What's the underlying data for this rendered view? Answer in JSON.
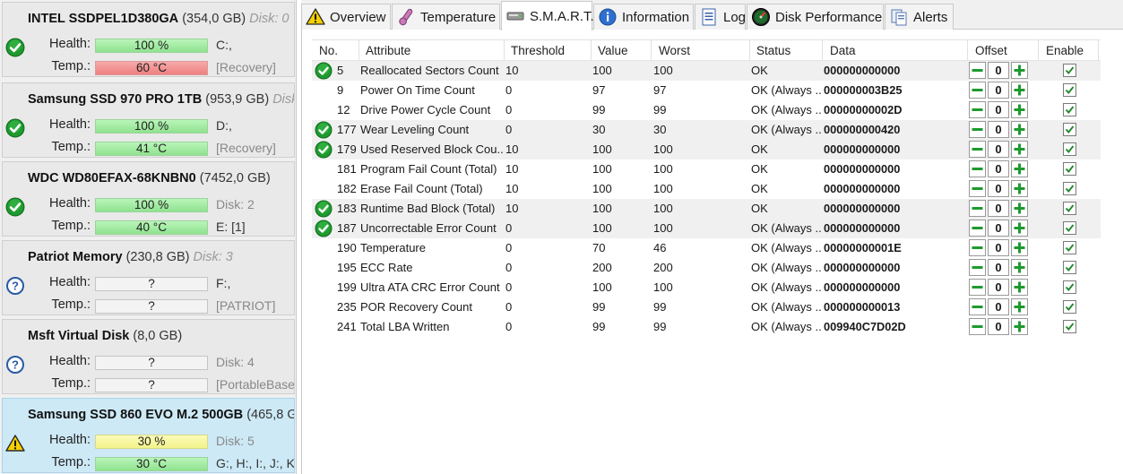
{
  "disks": [
    {
      "name": "INTEL SSDPEL1D380GA",
      "size": "(354,0 GB)",
      "disk_label": "Disk: 0",
      "status": "ok",
      "health_label": "Health:",
      "health_value": "100 %",
      "health_color": "green",
      "drives": "C:,",
      "temp_label": "Temp.:",
      "temp_value": "60 °C",
      "temp_color": "red",
      "volume": "[Recovery]"
    },
    {
      "name": "Samsung SSD 970 PRO 1TB",
      "size": "(953,9 GB)",
      "disk_label": "Disk",
      "status": "ok",
      "health_label": "Health:",
      "health_value": "100 %",
      "health_color": "green",
      "drives": "D:,",
      "temp_label": "Temp.:",
      "temp_value": "41 °C",
      "temp_color": "green",
      "volume": "[Recovery]"
    },
    {
      "name": "WDC WD80EFAX-68KNBN0",
      "size": "(7452,0 GB)",
      "disk_label": "",
      "status": "ok",
      "health_label": "Health:",
      "health_value": "100 %",
      "health_color": "green",
      "drives": "Disk: 2",
      "temp_label": "Temp.:",
      "temp_value": "40 °C",
      "temp_color": "green",
      "volume": "E: [1]"
    },
    {
      "name": "Patriot Memory",
      "size": "(230,8 GB)",
      "disk_label": "Disk: 3",
      "status": "unknown",
      "health_label": "Health:",
      "health_value": "?",
      "health_color": "empty",
      "drives": "F:,",
      "temp_label": "Temp.:",
      "temp_value": "?",
      "temp_color": "empty",
      "volume": "[PATRIOT]"
    },
    {
      "name": "Msft    Virtual Disk",
      "size": "(8,0 GB)",
      "disk_label": "",
      "status": "unknown",
      "health_label": "Health:",
      "health_value": "?",
      "health_color": "empty",
      "drives": "Disk: 4",
      "temp_label": "Temp.:",
      "temp_value": "?",
      "temp_color": "empty",
      "volume": "[PortableBase"
    },
    {
      "name": "Samsung SSD 860 EVO M.2 500GB",
      "size": "(465,8 G",
      "disk_label": "",
      "status": "warning",
      "health_label": "Health:",
      "health_value": "30 %",
      "health_color": "yellow",
      "drives": "Disk: 5",
      "temp_label": "Temp.:",
      "temp_value": "30 °C",
      "temp_color": "green",
      "volume": "G:, H:, I:, J:, K:"
    }
  ],
  "tabs": [
    {
      "label": "Overview",
      "icon": "warning-icon"
    },
    {
      "label": "Temperature",
      "icon": "thermometer-icon"
    },
    {
      "label": "S.M.A.R.T.",
      "icon": "drive-icon"
    },
    {
      "label": "Information",
      "icon": "info-icon"
    },
    {
      "label": "Log",
      "icon": "log-icon"
    },
    {
      "label": "Disk Performance",
      "icon": "gauge-icon"
    },
    {
      "label": "Alerts",
      "icon": "alerts-icon"
    }
  ],
  "active_tab": "S.M.A.R.T.",
  "columns": {
    "no": "No.",
    "attribute": "Attribute",
    "threshold": "Threshold",
    "value": "Value",
    "worst": "Worst",
    "status": "Status",
    "data": "Data",
    "offset": "Offset",
    "enable": "Enable"
  },
  "rows": [
    {
      "no": "5",
      "attribute": "Reallocated Sectors Count",
      "threshold": "10",
      "value": "100",
      "worst": "100",
      "status": "OK",
      "data": "000000000000",
      "offset": "0",
      "enabled": true,
      "ok_icon": true
    },
    {
      "no": "9",
      "attribute": "Power On Time Count",
      "threshold": "0",
      "value": "97",
      "worst": "97",
      "status": "OK (Always ...",
      "data": "000000003B25",
      "offset": "0",
      "enabled": true,
      "ok_icon": false
    },
    {
      "no": "12",
      "attribute": "Drive Power Cycle Count",
      "threshold": "0",
      "value": "99",
      "worst": "99",
      "status": "OK (Always ...",
      "data": "00000000002D",
      "offset": "0",
      "enabled": true,
      "ok_icon": false
    },
    {
      "no": "177",
      "attribute": "Wear Leveling Count",
      "threshold": "0",
      "value": "30",
      "worst": "30",
      "status": "OK (Always ...",
      "data": "000000000420",
      "offset": "0",
      "enabled": true,
      "ok_icon": true
    },
    {
      "no": "179",
      "attribute": "Used Reserved Block Cou...",
      "threshold": "10",
      "value": "100",
      "worst": "100",
      "status": "OK",
      "data": "000000000000",
      "offset": "0",
      "enabled": true,
      "ok_icon": true
    },
    {
      "no": "181",
      "attribute": "Program Fail Count (Total)",
      "threshold": "10",
      "value": "100",
      "worst": "100",
      "status": "OK",
      "data": "000000000000",
      "offset": "0",
      "enabled": true,
      "ok_icon": false
    },
    {
      "no": "182",
      "attribute": "Erase Fail Count (Total)",
      "threshold": "10",
      "value": "100",
      "worst": "100",
      "status": "OK",
      "data": "000000000000",
      "offset": "0",
      "enabled": true,
      "ok_icon": false
    },
    {
      "no": "183",
      "attribute": "Runtime Bad Block (Total)",
      "threshold": "10",
      "value": "100",
      "worst": "100",
      "status": "OK",
      "data": "000000000000",
      "offset": "0",
      "enabled": true,
      "ok_icon": true
    },
    {
      "no": "187",
      "attribute": "Uncorrectable Error Count",
      "threshold": "0",
      "value": "100",
      "worst": "100",
      "status": "OK (Always ...",
      "data": "000000000000",
      "offset": "0",
      "enabled": true,
      "ok_icon": true
    },
    {
      "no": "190",
      "attribute": "Temperature",
      "threshold": "0",
      "value": "70",
      "worst": "46",
      "status": "OK (Always ...",
      "data": "00000000001E",
      "offset": "0",
      "enabled": true,
      "ok_icon": false
    },
    {
      "no": "195",
      "attribute": "ECC Rate",
      "threshold": "0",
      "value": "200",
      "worst": "200",
      "status": "OK (Always ...",
      "data": "000000000000",
      "offset": "0",
      "enabled": true,
      "ok_icon": false
    },
    {
      "no": "199",
      "attribute": "Ultra ATA CRC Error Count",
      "threshold": "0",
      "value": "100",
      "worst": "100",
      "status": "OK (Always ...",
      "data": "000000000000",
      "offset": "0",
      "enabled": true,
      "ok_icon": false
    },
    {
      "no": "235",
      "attribute": "POR Recovery Count",
      "threshold": "0",
      "value": "99",
      "worst": "99",
      "status": "OK (Always ...",
      "data": "000000000013",
      "offset": "0",
      "enabled": true,
      "ok_icon": false
    },
    {
      "no": "241",
      "attribute": "Total LBA Written",
      "threshold": "0",
      "value": "99",
      "worst": "99",
      "status": "OK (Always ...",
      "data": "009940C7D02D",
      "offset": "0",
      "enabled": true,
      "ok_icon": false
    }
  ],
  "shaded_rows": [
    0,
    3,
    4,
    7,
    8
  ]
}
